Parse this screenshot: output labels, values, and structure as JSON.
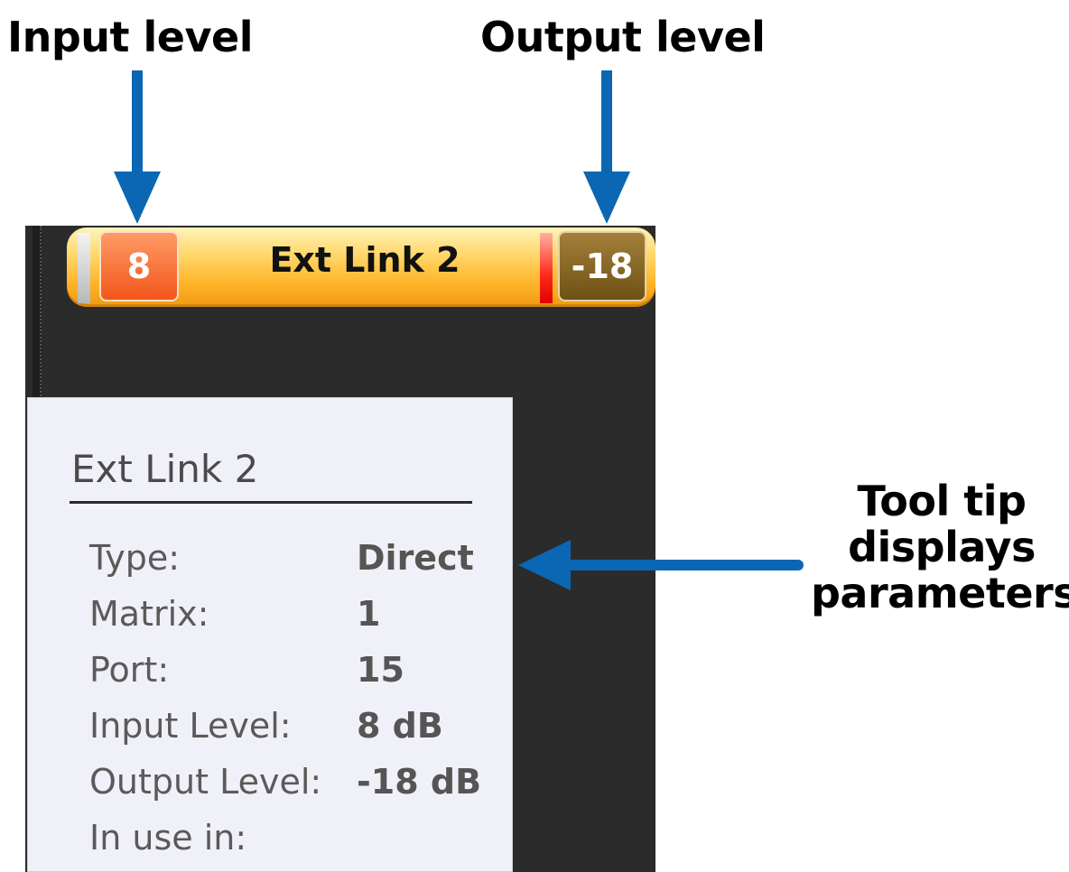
{
  "callouts": {
    "input_level": "Input level",
    "output_level": "Output level",
    "tooltip_line1": "Tool tip",
    "tooltip_line2": "displays",
    "tooltip_line3": "parameters"
  },
  "node": {
    "name": "Ext Link 2",
    "input_level": "8",
    "output_level": "-18"
  },
  "tooltip": {
    "title": "Ext Link 2",
    "rows": [
      {
        "key": "Type:",
        "value": "Direct"
      },
      {
        "key": "Matrix:",
        "value": "1"
      },
      {
        "key": "Port:",
        "value": "15"
      },
      {
        "key": "Input Level:",
        "value": "8 dB"
      },
      {
        "key": "Output Level:",
        "value": "-18 dB"
      },
      {
        "key": "In use in:",
        "value": ""
      }
    ]
  },
  "colors": {
    "arrow": "#0b67b3",
    "panel_bg": "#2b2b2b",
    "input_badge": "#f2561a",
    "output_badge": "#6e5115",
    "tooltip_bg": "#f0f1f8"
  }
}
